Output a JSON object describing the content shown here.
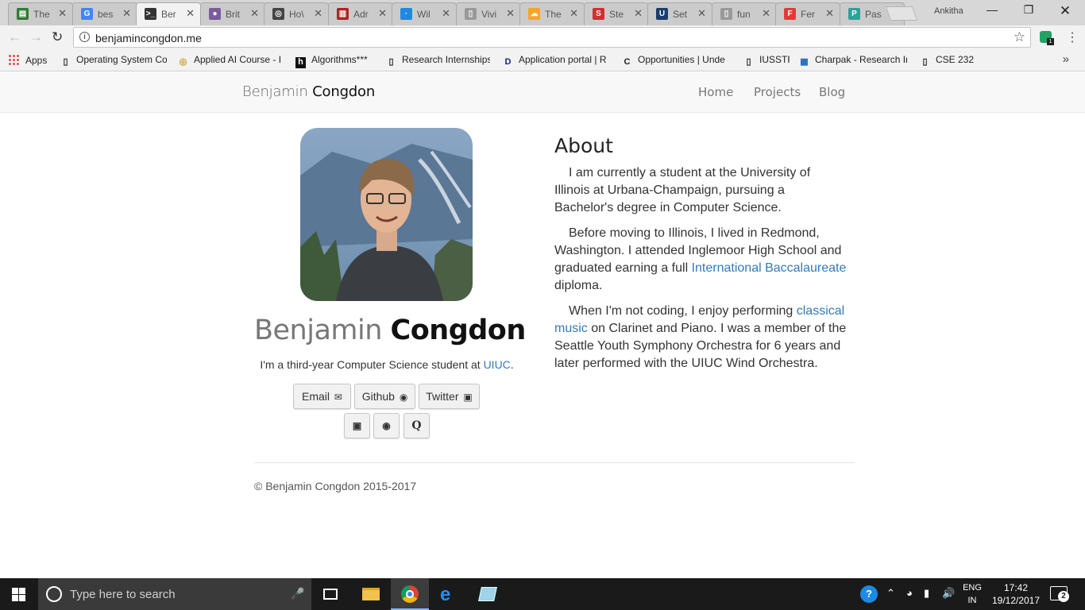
{
  "browser": {
    "tabs": [
      {
        "label": "The",
        "favicon": "book-icon",
        "color": "#2e7d32",
        "glyph": "▤"
      },
      {
        "label": "bes",
        "favicon": "google-icon",
        "color": "#4285f4",
        "glyph": "G"
      },
      {
        "label": "Ber",
        "favicon": "terminal-icon",
        "color": "#333333",
        "glyph": ">_",
        "active": true
      },
      {
        "label": "Brit",
        "favicon": "avatar-icon",
        "color": "#7a5c9e",
        "glyph": "●"
      },
      {
        "label": "Ho\\",
        "favicon": "globe-icon",
        "color": "#444444",
        "glyph": "◎"
      },
      {
        "label": "Adr",
        "favicon": "bars-icon",
        "color": "#b22222",
        "glyph": "▥"
      },
      {
        "label": "Wil",
        "favicon": "dot-icon",
        "color": "#1e88e5",
        "glyph": "·"
      },
      {
        "label": "Vivi",
        "favicon": "page-icon",
        "color": "#999999",
        "glyph": "▯"
      },
      {
        "label": "The",
        "favicon": "cloud-icon",
        "color": "#f5a623",
        "glyph": "☁"
      },
      {
        "label": "Ste",
        "favicon": "s-icon",
        "color": "#d32f2f",
        "glyph": "S"
      },
      {
        "label": "Set",
        "favicon": "ubc-icon",
        "color": "#1a3c6e",
        "glyph": "U"
      },
      {
        "label": "fun",
        "favicon": "page-icon",
        "color": "#999999",
        "glyph": "▯"
      },
      {
        "label": "Fer",
        "favicon": "f-icon",
        "color": "#e53935",
        "glyph": "F"
      },
      {
        "label": "Pas",
        "favicon": "p-icon",
        "color": "#26a69a",
        "glyph": "P"
      }
    ],
    "profile_name": "Ankitha",
    "url": "benjamincongdon.me",
    "extension_badge": "1",
    "bookmarks": [
      {
        "label": "Apps",
        "icon": "apps-grid-icon"
      },
      {
        "label": "Operating System Co",
        "icon": "page-icon"
      },
      {
        "label": "Applied AI Course - I",
        "icon": "ai-icon"
      },
      {
        "label": "Algorithms***",
        "icon": "h-icon"
      },
      {
        "label": "Research Internships",
        "icon": "page-icon"
      },
      {
        "label": "Application portal | R",
        "icon": "dj-icon"
      },
      {
        "label": "Opportunities | Unde",
        "icon": "cal-icon"
      },
      {
        "label": "IUSSTF",
        "icon": "page-icon"
      },
      {
        "label": "Charpak - Research In",
        "icon": "charpak-icon"
      },
      {
        "label": "CSE 232",
        "icon": "page-icon"
      }
    ]
  },
  "site": {
    "brand_first": "Benjamin",
    "brand_last": "Congdon",
    "nav": [
      "Home",
      "Projects",
      "Blog"
    ],
    "name_first": "Benjamin",
    "name_last": "Congdon",
    "tagline_pre": "I'm a third-year Computer Science student at ",
    "tagline_link": "UIUC",
    "tagline_post": ".",
    "buttons": [
      "Email",
      "Github",
      "Twitter"
    ],
    "icon_buttons": [
      "linkedin-icon",
      "fingerprint-icon",
      "q-icon"
    ],
    "about_title": "About",
    "para1": "I am currently a student at the University of Illinois at Urbana-Champaign, pursuing a Bachelor's degree in Computer Science.",
    "para2_pre": "Before moving to Illinois, I lived in Redmond, Washington. I attended Inglemoor High School and graduated earning a full ",
    "para2_link": "International Baccalaureate",
    "para2_post": " diploma.",
    "para3_pre": "When I'm not coding, I enjoy performing ",
    "para3_link": "classical music",
    "para3_post": " on Clarinet and Piano. I was a member of the Seattle Youth Symphony Orchestra for 6 years and later performed with the UIUC Wind Orchestra.",
    "footer": "© Benjamin Congdon 2015-2017",
    "link_color": "#337ab7"
  },
  "taskbar": {
    "search_placeholder": "Type here to search",
    "lang_top": "ENG",
    "lang_bottom": "IN",
    "time": "17:42",
    "date": "19/12/2017",
    "notifications": "2"
  }
}
